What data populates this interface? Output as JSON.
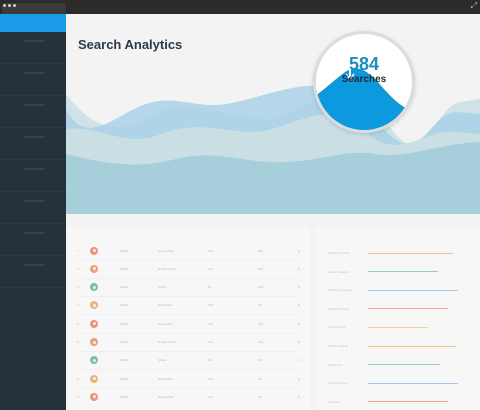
{
  "window": {
    "resize_icon": "resize-diagonal-icon"
  },
  "page": {
    "title": "Search Analytics"
  },
  "highlight": {
    "count": "584",
    "label": "Searches"
  },
  "colors": {
    "accent": "#1e9be8",
    "sidebar": "#25323b",
    "area_front": "#8ec8e0",
    "area_mid": "#cfe2e6",
    "area_back": "#a9d1e6",
    "magnified_peak": "#0c99dd"
  },
  "table_rows": [
    {
      "n": "1",
      "avatar": "#e9967a",
      "a": "42003",
      "b": "Jessie Platt",
      "c": "143",
      "d": "285",
      "e": "$"
    },
    {
      "n": "2",
      "avatar": "#e8a07f",
      "a": "42001",
      "b": "Robert Smith",
      "c": "142",
      "d": "184",
      "e": "$"
    },
    {
      "n": "3",
      "avatar": "#7fbfa0",
      "a": "42002",
      "b": "Shane",
      "c": "51",
      "d": "135",
      "e": "$"
    },
    {
      "n": "4",
      "avatar": "#f0b27a",
      "a": "42002",
      "b": "David Blick",
      "c": "120",
      "d": "96",
      "e": "$"
    },
    {
      "n": "5",
      "avatar": "#e9967a",
      "a": "42003",
      "b": "Jessie Best",
      "c": "132",
      "d": "205",
      "e": "$"
    },
    {
      "n": "6",
      "avatar": "#e8a07f",
      "a": "42001",
      "b": "Robert Smith",
      "c": "142",
      "d": "184",
      "e": "$"
    },
    {
      "n": "7",
      "avatar": "#7fbfa0",
      "a": "42002",
      "b": "Shane",
      "c": "94",
      "d": "125",
      "e": "$"
    },
    {
      "n": "8",
      "avatar": "#f0b27a",
      "a": "42004",
      "b": "David Blick",
      "c": "125",
      "d": "96",
      "e": "$"
    },
    {
      "n": "9",
      "avatar": "#e9967a",
      "a": "42003",
      "b": "Jessie Platt",
      "c": "143",
      "d": "85",
      "e": "$"
    }
  ],
  "legend": [
    {
      "label": "Sports & Leisure",
      "color": "#f5c08a",
      "fill": 0.85
    },
    {
      "label": "Home & Garden",
      "color": "#8fd3b0",
      "fill": 0.7
    },
    {
      "label": "Clothing & Apparel",
      "color": "#a9c8ee",
      "fill": 0.9
    },
    {
      "label": "Health & Beauty",
      "color": "#f3a48f",
      "fill": 0.8
    },
    {
      "label": "Food & Drink",
      "color": "#f5d58a",
      "fill": 0.6
    },
    {
      "label": "Books & Media",
      "color": "#f5c08a",
      "fill": 0.88
    },
    {
      "label": "Electronics",
      "color": "#8fd3b0",
      "fill": 0.72
    },
    {
      "label": "Toys & Games",
      "color": "#a9c8ee",
      "fill": 0.9
    },
    {
      "label": "Jewellery",
      "color": "#f3a48f",
      "fill": 0.8
    }
  ]
}
